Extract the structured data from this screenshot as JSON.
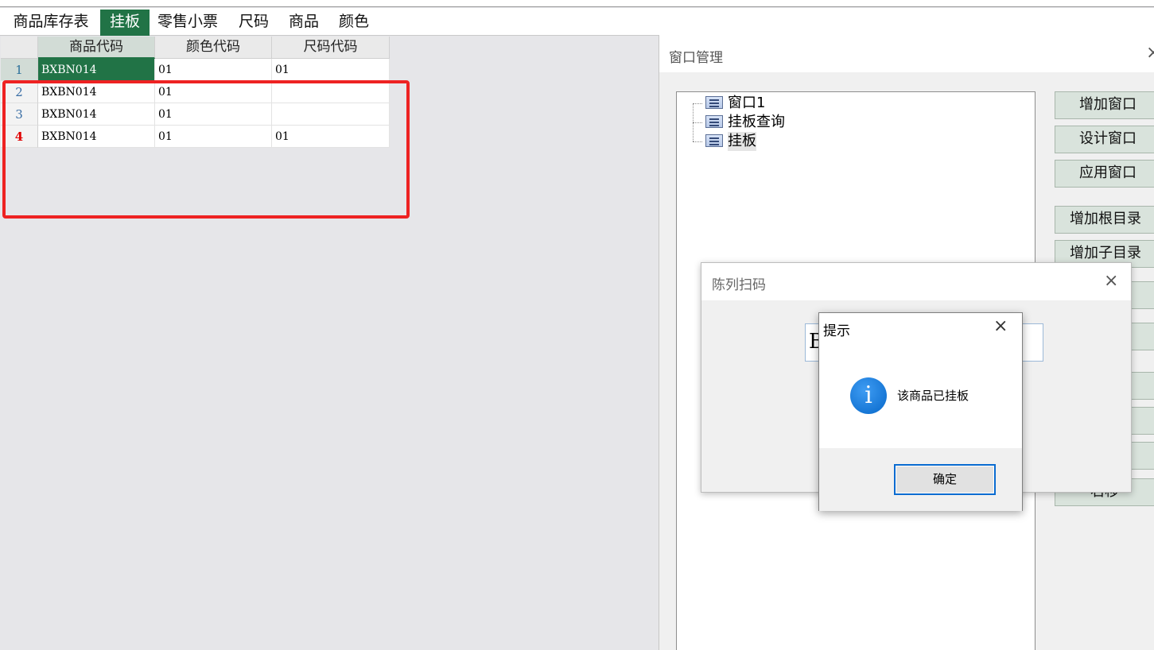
{
  "tabs": [
    {
      "label": "商品库存表",
      "active": false
    },
    {
      "label": "挂板",
      "active": true
    },
    {
      "label": "零售小票",
      "active": false
    },
    {
      "label": "尺码",
      "active": false
    },
    {
      "label": "商品",
      "active": false
    },
    {
      "label": "颜色",
      "active": false
    }
  ],
  "grid": {
    "headers": [
      "商品代码",
      "颜色代码",
      "尺码代码"
    ],
    "rows": [
      {
        "num": "1",
        "cells": [
          "BXBN014",
          "01",
          "01"
        ]
      },
      {
        "num": "2",
        "cells": [
          "BXBN014",
          "01",
          ""
        ]
      },
      {
        "num": "3",
        "cells": [
          "BXBN014",
          "01",
          ""
        ]
      },
      {
        "num": "4",
        "cells": [
          "BXBN014",
          "01",
          "01"
        ]
      }
    ]
  },
  "window_manager": {
    "title": "窗口管理",
    "close": "×",
    "tree": [
      "窗口1",
      "挂板查询",
      "挂板"
    ],
    "buttons": [
      "增加窗口",
      "设计窗口",
      "应用窗口",
      "增加根目录",
      "增加子目录",
      "右移"
    ]
  },
  "scan_dialog": {
    "title": "陈列扫码",
    "close": "×",
    "input_value": "B"
  },
  "message_box": {
    "title": "提示",
    "close": "×",
    "icon": "info-icon",
    "icon_glyph": "i",
    "text": "该商品已挂板",
    "ok_label": "确定"
  },
  "colors": {
    "accent": "#217346",
    "highlight_border": "#ee2222",
    "button_bg": "#d9e3dc"
  }
}
